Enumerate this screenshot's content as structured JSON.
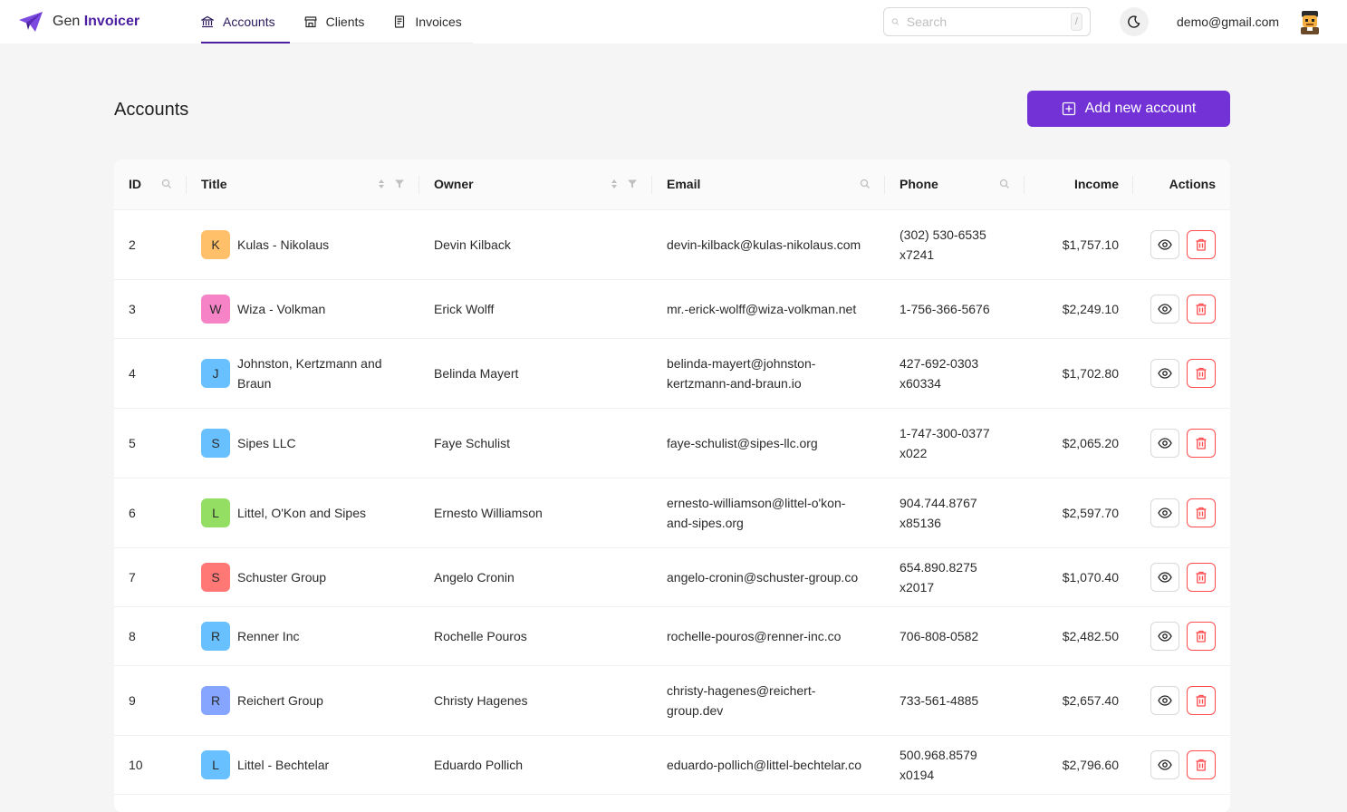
{
  "brand": {
    "prefix": "Gen",
    "name": "Invoicer"
  },
  "nav": [
    {
      "label": "Accounts",
      "icon": "bank-icon",
      "active": true
    },
    {
      "label": "Clients",
      "icon": "shop-icon",
      "active": false
    },
    {
      "label": "Invoices",
      "icon": "document-icon",
      "active": false
    }
  ],
  "search": {
    "placeholder": "Search",
    "shortcut": "/"
  },
  "user": {
    "email": "demo@gmail.com"
  },
  "page": {
    "title": "Accounts",
    "add_label": "Add new account"
  },
  "table": {
    "columns": [
      "ID",
      "Title",
      "Owner",
      "Email",
      "Phone",
      "Income",
      "Actions"
    ],
    "rows": [
      {
        "id": "2",
        "initial": "K",
        "color": "#ffc069",
        "title": "Kulas - Nikolaus",
        "owner": "Devin Kilback",
        "email": "devin-kilback@kulas-nikolaus.com",
        "phone": "(302) 530-6535 x7241",
        "income": "$1,757.10",
        "tall": true
      },
      {
        "id": "3",
        "initial": "W",
        "color": "#f783c7",
        "title": "Wiza - Volkman",
        "owner": "Erick Wolff",
        "email": "mr.-erick-wolff@wiza-volkman.net",
        "phone": "1-756-366-5676",
        "income": "$2,249.10",
        "tall": false
      },
      {
        "id": "4",
        "initial": "J",
        "color": "#69c0ff",
        "title": "Johnston, Kertzmann and Braun",
        "owner": "Belinda Mayert",
        "email": "belinda-mayert@johnston-kertzmann-and-braun.io",
        "phone": "427-692-0303 x60334",
        "income": "$1,702.80",
        "tall": true
      },
      {
        "id": "5",
        "initial": "S",
        "color": "#69c0ff",
        "title": "Sipes LLC",
        "owner": "Faye Schulist",
        "email": "faye-schulist@sipes-llc.org",
        "phone": "1-747-300-0377 x022",
        "income": "$2,065.20",
        "tall": true
      },
      {
        "id": "6",
        "initial": "L",
        "color": "#95de64",
        "title": "Littel, O'Kon and Sipes",
        "owner": "Ernesto Williamson",
        "email": "ernesto-williamson@littel-o'kon-and-sipes.org",
        "phone": "904.744.8767 x85136",
        "income": "$2,597.70",
        "tall": true
      },
      {
        "id": "7",
        "initial": "S",
        "color": "#ff7875",
        "title": "Schuster Group",
        "owner": "Angelo Cronin",
        "email": "angelo-cronin@schuster-group.co",
        "phone": "654.890.8275 x2017",
        "income": "$1,070.40",
        "tall": false
      },
      {
        "id": "8",
        "initial": "R",
        "color": "#69c0ff",
        "title": "Renner Inc",
        "owner": "Rochelle Pouros",
        "email": "rochelle-pouros@renner-inc.co",
        "phone": "706-808-0582",
        "income": "$2,482.50",
        "tall": false
      },
      {
        "id": "9",
        "initial": "R",
        "color": "#85a5ff",
        "title": "Reichert Group",
        "owner": "Christy Hagenes",
        "email": "christy-hagenes@reichert-group.dev",
        "phone": "733-561-4885",
        "income": "$2,657.40",
        "tall": true
      },
      {
        "id": "10",
        "initial": "L",
        "color": "#69c0ff",
        "title": "Littel - Bechtelar",
        "owner": "Eduardo Pollich",
        "email": "eduardo-pollich@littel-bechtelar.co",
        "phone": "500.968.8579 x0194",
        "income": "$2,796.60",
        "tall": false
      }
    ]
  },
  "colors": {
    "accent": "#7332d6",
    "danger": "#ff4d4f",
    "brand_dark": "#4b1fa0"
  }
}
